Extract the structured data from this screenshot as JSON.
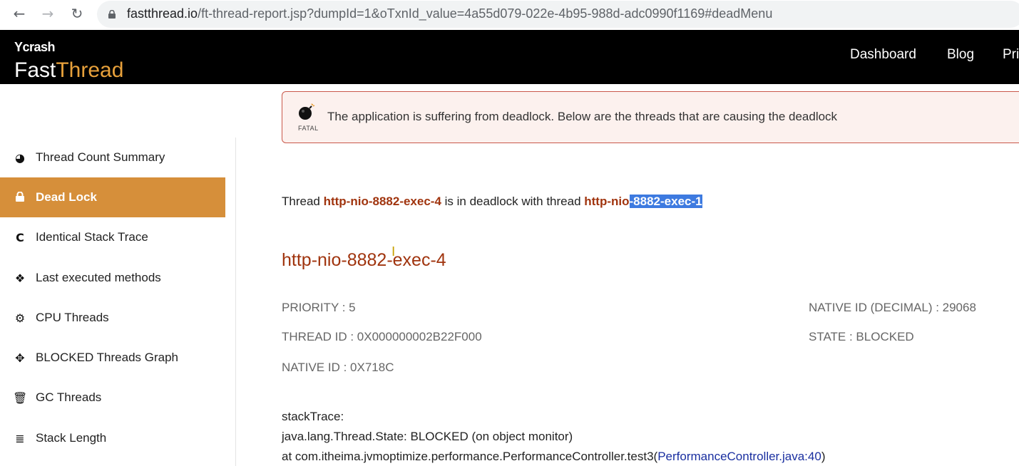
{
  "browser": {
    "back_icon": "←",
    "forward_icon": "→",
    "reload_icon": "↻",
    "url_host": "fastthread.io",
    "url_path": "/ft-thread-report.jsp?dumpId=1&oTxnId_value=4a55d079-022e-4b95-988d-adc0990f1169#deadMenu"
  },
  "header": {
    "logo_small": "Ycrash",
    "logo_fast": "Fast",
    "logo_thread": "Thread",
    "nav": [
      "Dashboard",
      "Blog",
      "Pri"
    ]
  },
  "sidebar": {
    "items": [
      {
        "label": "Thread Count Summary",
        "icon": "◕"
      },
      {
        "label": "Dead Lock",
        "icon": "🔒"
      },
      {
        "label": "Identical Stack Trace",
        "icon": "C"
      },
      {
        "label": "Last executed methods",
        "icon": "❖"
      },
      {
        "label": "CPU Threads",
        "icon": "⚙"
      },
      {
        "label": "BLOCKED Threads Graph",
        "icon": "✥"
      },
      {
        "label": "GC Threads",
        "icon": "🗑"
      },
      {
        "label": "Stack Length",
        "icon": "≣"
      }
    ]
  },
  "alert": {
    "tag": "FATAL",
    "message": "The application is suffering from deadlock. Below are the threads that are causing the deadlock"
  },
  "deadlock": {
    "prefix": "Thread ",
    "thread_a": "http-nio-8882-exec-4",
    "middle": " is in deadlock with thread ",
    "thread_b_plain": "http-nio",
    "thread_b_selected": "-8882-exec-1"
  },
  "thread": {
    "title": "http-nio-8882-exec-4",
    "priority": "PRIORITY : 5",
    "thread_id": "THREAD ID : 0X000000002B22F000",
    "native_id": "NATIVE ID : 0X718C",
    "native_id_decimal": "NATIVE ID (DECIMAL) : 29068",
    "state": "STATE : BLOCKED",
    "stack_label": "stackTrace:",
    "stack_line1": "java.lang.Thread.State: BLOCKED (on object monitor)",
    "stack_line2_prefix": "at com.itheima.jvmoptimize.performance.PerformanceController.test3(",
    "stack_line2_link": "PerformanceController.java:40",
    "stack_line2_suffix": ")"
  }
}
